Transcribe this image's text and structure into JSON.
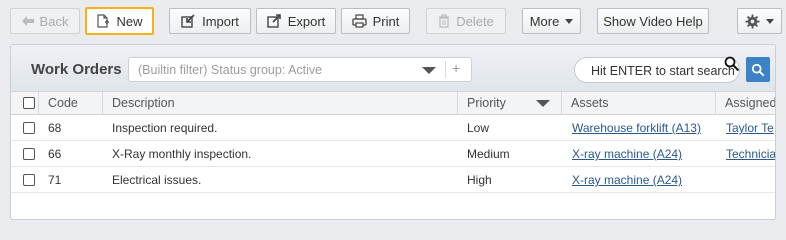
{
  "toolbar": {
    "back": "Back",
    "new": "New",
    "import": "Import",
    "export": "Export",
    "print": "Print",
    "delete": "Delete",
    "more": "More",
    "video_help": "Show Video Help"
  },
  "panel": {
    "title": "Work Orders",
    "filter_placeholder": "(Builtin filter) Status group: Active",
    "filter_add": "+",
    "search_placeholder": "Hit ENTER to start search"
  },
  "table": {
    "columns": [
      "Code",
      "Description",
      "Priority",
      "Assets",
      "Assigned"
    ],
    "rows": [
      {
        "code": "68",
        "description": "Inspection required.",
        "priority": "Low",
        "asset": "Warehouse forklift (A13)",
        "assigned": "Taylor Te"
      },
      {
        "code": "66",
        "description": "X-Ray monthly inspection.",
        "priority": "Medium",
        "asset": "X-ray machine (A24)",
        "assigned": "Technicia"
      },
      {
        "code": "71",
        "description": "Electrical issues.",
        "priority": "High",
        "asset": "X-ray machine (A24)",
        "assigned": ""
      }
    ]
  },
  "colors": {
    "highlight": "#f3b21c",
    "search_button": "#3d82c4",
    "link": "#29598e"
  }
}
